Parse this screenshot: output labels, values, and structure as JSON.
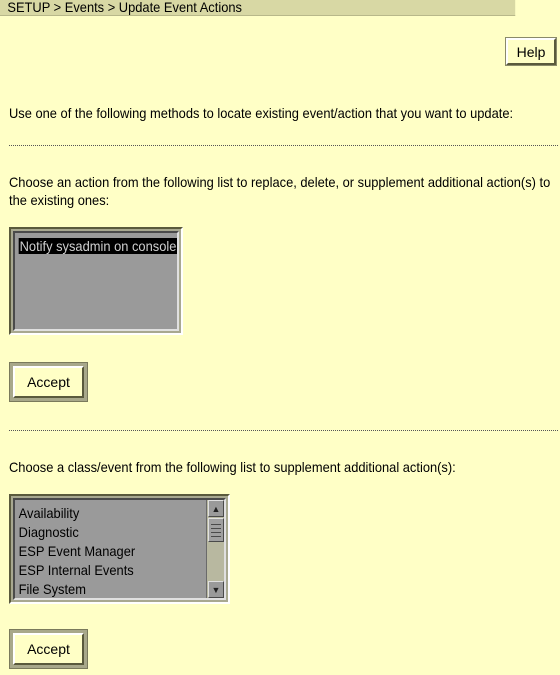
{
  "breadcrumb": "SETUP > Events > Update Event Actions",
  "help_label": "Help",
  "intro_text": "Use one of the following methods to locate existing event/action that you want to update:",
  "section_action": {
    "instruction": "Choose an action from the following list to replace, delete, or supplement additional action(s) to the existing ones:",
    "items": [
      "Notify sysadmin on console"
    ],
    "selected_index": 0,
    "accept_label": "Accept"
  },
  "section_class": {
    "instruction": "Choose a class/event from the following list to supplement additional action(s):",
    "items": [
      "Availability",
      "Diagnostic",
      "ESP Event Manager",
      "ESP Internal Events",
      "File System"
    ],
    "scroll_up_icon": "triangle-up",
    "scroll_down_icon": "triangle-down",
    "accept_label": "Accept"
  }
}
